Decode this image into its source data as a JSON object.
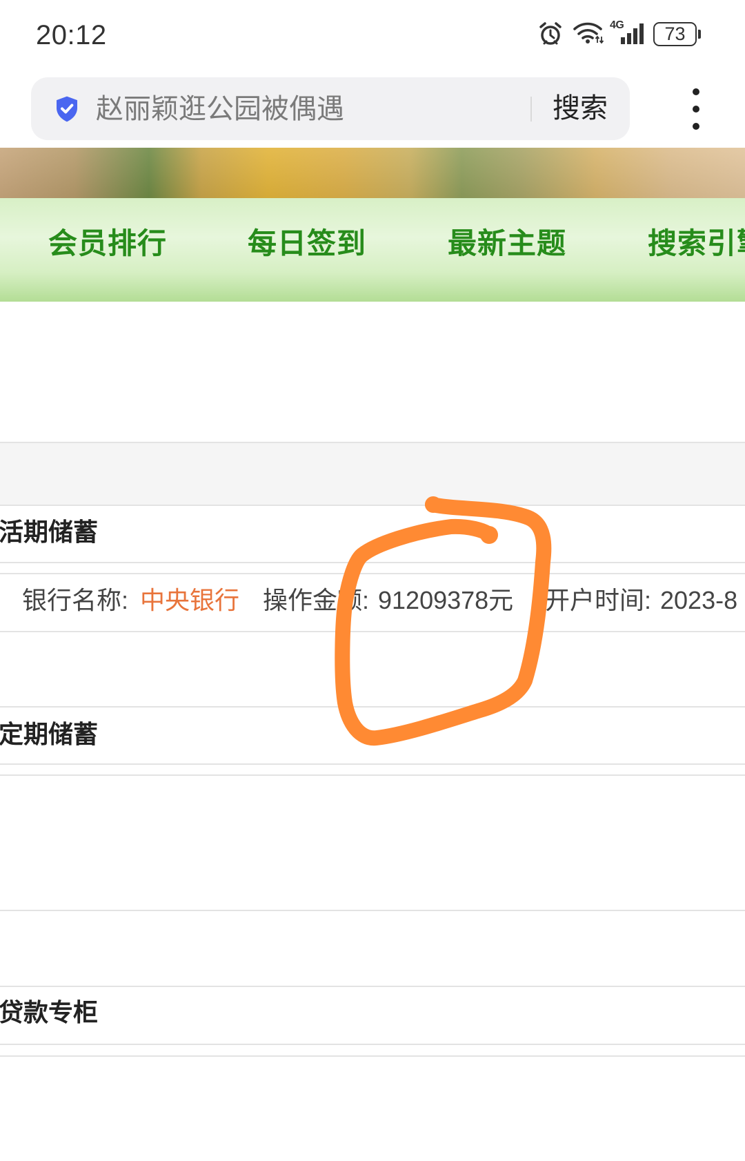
{
  "status_bar": {
    "time": "20:12",
    "network_label": "4G",
    "battery_level": "73",
    "icons": [
      "alarm-icon",
      "wifi-icon",
      "signal-icon",
      "battery-icon"
    ]
  },
  "browser": {
    "security_icon": "shield-check-icon",
    "search_query": "赵丽颖逛公园被偶遇",
    "search_button": "搜索",
    "menu_icon": "more-vertical-icon"
  },
  "nav": {
    "items": [
      {
        "label": "会员排行"
      },
      {
        "label": "每日签到"
      },
      {
        "label": "最新主题"
      },
      {
        "label": "搜索引擎"
      }
    ]
  },
  "sections": {
    "current_savings": {
      "title": "活期储蓄",
      "record": {
        "bank_label": "银行名称:",
        "bank_name": "中央银行",
        "amount_label": "操作金额:",
        "amount": "91209378元",
        "open_time_label": "开户时间:",
        "open_time": "2023-8"
      }
    },
    "fixed_savings": {
      "title": "定期储蓄"
    },
    "loans": {
      "title": "贷款专柜"
    }
  },
  "colors": {
    "nav_text": "#278c1b",
    "bank_name": "#e8743b",
    "annotation": "#ff8a33",
    "security_icon": "#4a66f0"
  }
}
